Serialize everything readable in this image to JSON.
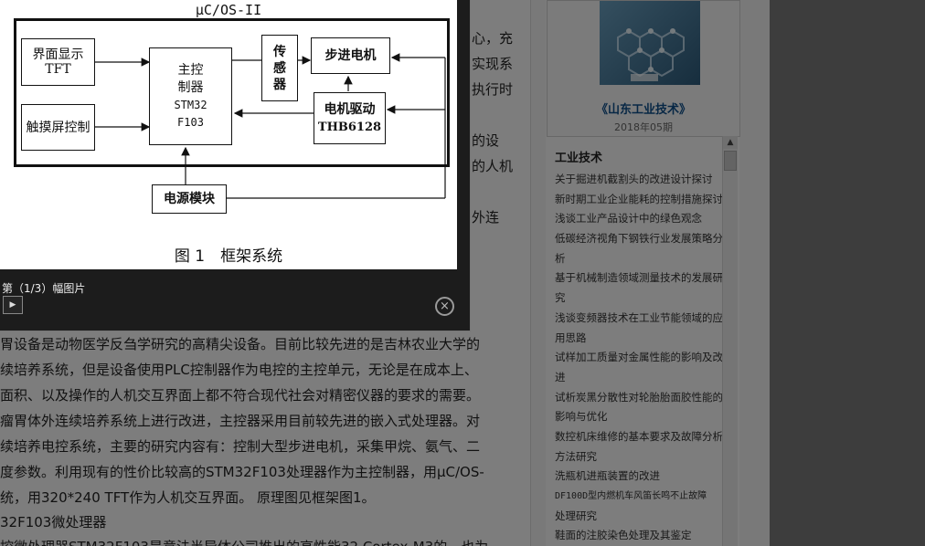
{
  "article": {
    "lines_right_of_popup": [
      "心，充",
      "实现系",
      "执行时",
      "的设",
      "的人机",
      "外连"
    ],
    "lines": [
      "胃设备是动物医学反刍学研究的高精尖设备。目前比较先进的是吉林农业大学的",
      "续培养系统，但是设备使用PLC控制器作为电控的主控单元，无论是在成本上、",
      "面积、以及操作的人机交互界面上都不符合现代社会对精密仪器的要求的需要。",
      "瘤胃体外连续培养系统上进行改进，主控器采用目前较先进的嵌入式处理器。对",
      "续培养电控系统，主要的研究内容有：控制大型步进电机，采集甲烷、氨气、二",
      "度参数。利用现有的性价比较高的STM32F103处理器作为主控制器，用µC/OS-",
      "统，用320*240 TFT作为人机交互界面。 原理图见框架图1。",
      "32F103微处理器",
      "控微处理器STM32F103是意法半导体公司推出的高性能32 Cortex-M3的，也为"
    ]
  },
  "sidebar": {
    "journal_title": "《山东工业技术》",
    "journal_issue": "2018年05期",
    "section_title": "工业技术",
    "link_lines": [
      "关于掘进机截割头的改进设计探讨",
      "新时期工业企业能耗的控制措施探讨",
      "浅谈工业产品设计中的绿色观念",
      "低碳经济视角下钢铁行业发展策略分",
      "析",
      "基于机械制造领域测量技术的发展研",
      "究",
      "浅谈变频器技术在工业节能领域的应",
      "用思路",
      "试样加工质量对金属性能的影响及改",
      "进",
      "试析炭黑分散性对轮胎胎面胶性能的",
      "影响与优化",
      "数控机床维修的基本要求及故障分析",
      "方法研究",
      "洗瓶机进瓶装置的改进",
      "DF100D型内燃机车风笛长鸣不止故障",
      "处理研究",
      "鞋面的注胶染色处理及其鉴定"
    ]
  },
  "lightbox": {
    "counter": "第（1/3）幅图片",
    "next_icon": "▶",
    "close_icon": "×",
    "figure": {
      "title": "μC/OS-II",
      "boxes": {
        "display": [
          "界面显示",
          "TFT"
        ],
        "touch": "触摸屏控制",
        "mcu": [
          "主控",
          "制器",
          "STM32",
          "F103"
        ],
        "sensor": [
          "传",
          "感",
          "器"
        ],
        "stepper": "步进电机",
        "driver": [
          "电机驱动",
          "THB6128"
        ],
        "power": "电源模块"
      },
      "caption": "图 1　框架系统"
    }
  },
  "colors": {
    "journal_title": "#0e4f8a",
    "overlay": "#1c1c1c"
  }
}
